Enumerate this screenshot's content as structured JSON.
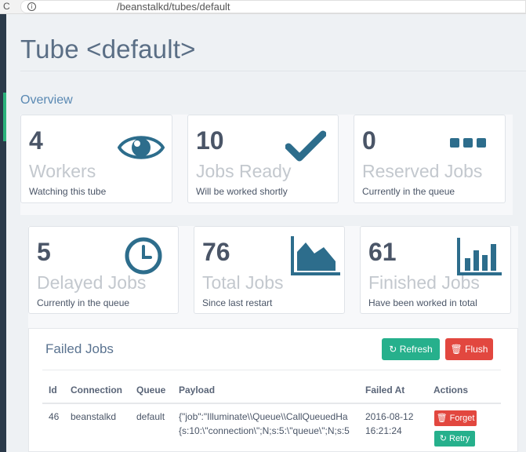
{
  "browser": {
    "reload_icon": "reload-icon",
    "info_icon": "info-icon",
    "url": "/beanstalkd/tubes/default"
  },
  "page": {
    "title": "Tube <default>",
    "section": "Overview"
  },
  "stats": [
    {
      "value": "4",
      "label": "Workers",
      "sub": "Watching this tube",
      "icon": "eye-icon"
    },
    {
      "value": "10",
      "label": "Jobs Ready",
      "sub": "Will be worked shortly",
      "icon": "checkmark-icon"
    },
    {
      "value": "0",
      "label": "Reserved Jobs",
      "sub": "Currently in the queue",
      "icon": "dots-icon"
    },
    {
      "value": "5",
      "label": "Delayed Jobs",
      "sub": "Currently in the queue",
      "icon": "clock-icon"
    },
    {
      "value": "76",
      "label": "Total Jobs",
      "sub": "Since last restart",
      "icon": "area-chart-icon"
    },
    {
      "value": "61",
      "label": "Finished Jobs",
      "sub": "Have been worked in total",
      "icon": "bar-chart-icon"
    }
  ],
  "failed_jobs": {
    "title": "Failed Jobs",
    "refresh_label": "Refresh",
    "flush_label": "Flush",
    "columns": [
      "Id",
      "Connection",
      "Queue",
      "Payload",
      "Failed At",
      "Actions"
    ],
    "rows": [
      {
        "id": "46",
        "connection": "beanstalkd",
        "queue": "default",
        "payload_line1": "{\"job\":\"Illuminate\\\\Queue\\\\CallQueuedHa",
        "payload_line2": "{s:10:\\\"connection\\\";N;s:5:\\\"queue\\\";N;s:5",
        "failed_date": "2016-08-12",
        "failed_time": "16:21:24",
        "forget_label": "Forget",
        "retry_label": "Retry"
      }
    ]
  },
  "colors": {
    "accent_green": "#26b08c",
    "danger_red": "#e2473f",
    "icon_blue": "#2d6d8c",
    "sidebar_dark": "#2b3a4a"
  }
}
